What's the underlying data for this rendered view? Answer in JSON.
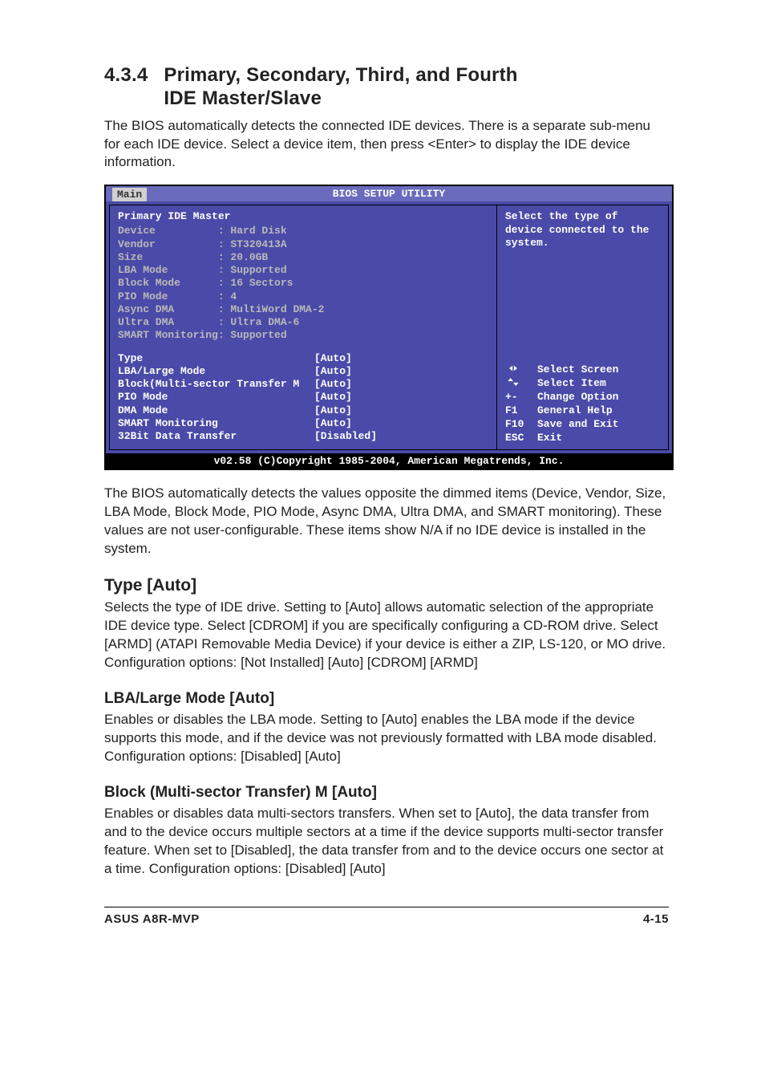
{
  "section": {
    "number": "4.3.4",
    "title_line1": "Primary, Secondary, Third, and Fourth",
    "title_line2": "IDE Master/Slave",
    "intro": "The BIOS automatically detects the connected IDE devices. There is a separate sub-menu for each IDE device. Select a device item, then press <Enter> to display the IDE device information."
  },
  "bios": {
    "title": "BIOS SETUP UTILITY",
    "tab": "Main",
    "panel_title": "Primary IDE Master",
    "dim_items": [
      {
        "label": "Device          ",
        "value": ": Hard Disk"
      },
      {
        "label": "Vendor          ",
        "value": ": ST320413A"
      },
      {
        "label": "Size            ",
        "value": ": 20.0GB"
      },
      {
        "label": "LBA Mode        ",
        "value": ": Supported"
      },
      {
        "label": "Block Mode      ",
        "value": ": 16 Sectors"
      },
      {
        "label": "PIO Mode        ",
        "value": ": 4"
      },
      {
        "label": "Async DMA       ",
        "value": ": MultiWord DMA-2"
      },
      {
        "label": "Ultra DMA       ",
        "value": ": Ultra DMA-6"
      },
      {
        "label": "SMART Monitoring",
        "value": ": Supported"
      }
    ],
    "settings": [
      {
        "label": "Type",
        "value": "[Auto]"
      },
      {
        "label": "LBA/Large Mode",
        "value": "[Auto]"
      },
      {
        "label": "Block(Multi-sector Transfer M",
        "value": "[Auto]"
      },
      {
        "label": "PIO Mode",
        "value": "[Auto]"
      },
      {
        "label": "DMA Mode",
        "value": "[Auto]"
      },
      {
        "label": "SMART Monitoring",
        "value": "[Auto]"
      },
      {
        "label": "32Bit Data Transfer",
        "value": "[Disabled]"
      }
    ],
    "help_text": "Select the type of device connected to the system.",
    "keys": [
      {
        "icon": "lr",
        "label": "Select Screen"
      },
      {
        "icon": "ud",
        "label": "Select Item"
      },
      {
        "icon": "+-",
        "label": "Change Option"
      },
      {
        "icon": "F1",
        "label": "General Help"
      },
      {
        "icon": "F10",
        "label": "Save and Exit"
      },
      {
        "icon": "ESC",
        "label": "Exit"
      }
    ],
    "copyright": "v02.58 (C)Copyright 1985-2004, American Megatrends, Inc."
  },
  "after_bios": "The BIOS automatically detects the values opposite the dimmed items (Device, Vendor, Size, LBA Mode, Block Mode, PIO Mode, Async DMA, Ultra DMA, and SMART monitoring). These values are not user-configurable. These items show N/A if no IDE device is installed in the system.",
  "type_section": {
    "heading": "Type [Auto]",
    "body": "Selects the type of IDE drive. Setting to [Auto] allows automatic selection of the appropriate IDE device type. Select [CDROM] if you are specifically configuring a CD-ROM drive. Select [ARMD] (ATAPI Removable Media Device) if your device is either a ZIP, LS-120, or MO drive. Configuration options: [Not Installed] [Auto] [CDROM] [ARMD]"
  },
  "lba_section": {
    "heading": "LBA/Large Mode [Auto]",
    "body": "Enables or disables the LBA mode. Setting to [Auto] enables the LBA mode if the device supports this mode, and if the device was not previously formatted with LBA mode disabled. Configuration options: [Disabled] [Auto]"
  },
  "block_section": {
    "heading": "Block (Multi-sector Transfer) M [Auto]",
    "body": "Enables or disables data multi-sectors transfers. When set to [Auto], the data transfer from and to the device occurs multiple sectors at a time if the device supports multi-sector transfer feature. When set to [Disabled], the data transfer from and to the device occurs one sector at a time. Configuration options: [Disabled] [Auto]"
  },
  "footer": {
    "left": "ASUS A8R-MVP",
    "right": "4-15"
  }
}
